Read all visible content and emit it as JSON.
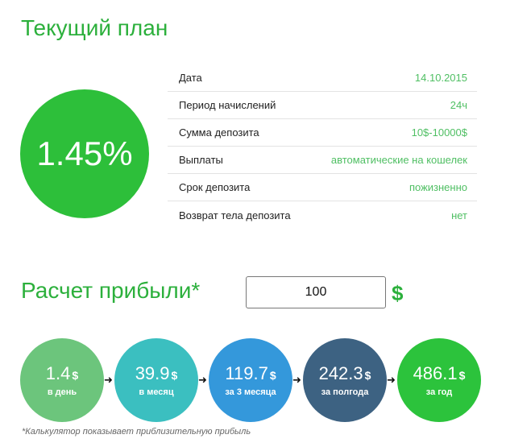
{
  "plan": {
    "title": "Текущий план",
    "rate": "1.45%",
    "details": [
      {
        "label": "Дата",
        "value": "14.10.2015"
      },
      {
        "label": "Период начислений",
        "value": "24ч"
      },
      {
        "label": "Сумма депозита",
        "value": "10$-10000$"
      },
      {
        "label": "Выплаты",
        "value": "автоматические на кошелек"
      },
      {
        "label": "Срок депозита",
        "value": "пожизненно"
      },
      {
        "label": "Возврат тела депозита",
        "value": "нет"
      }
    ]
  },
  "calculator": {
    "title": "Расчет прибыли*",
    "amount": "100",
    "currency": "$",
    "results": [
      {
        "amount": "1.4",
        "currency": "$",
        "period": "в день",
        "color": "#6cc57c"
      },
      {
        "amount": "39.9",
        "currency": "$",
        "period": "в месяц",
        "color": "#3bbfc0"
      },
      {
        "amount": "119.7",
        "currency": "$",
        "period": "за 3 месяца",
        "color": "#3498db"
      },
      {
        "amount": "242.3",
        "currency": "$",
        "period": "за полгода",
        "color": "#3d6282"
      },
      {
        "amount": "486.1",
        "currency": "$",
        "period": "за год",
        "color": "#2cc33c"
      }
    ],
    "arrow": "➜",
    "footnote": "*Калькулятор показывает приблизительную прибыль"
  }
}
